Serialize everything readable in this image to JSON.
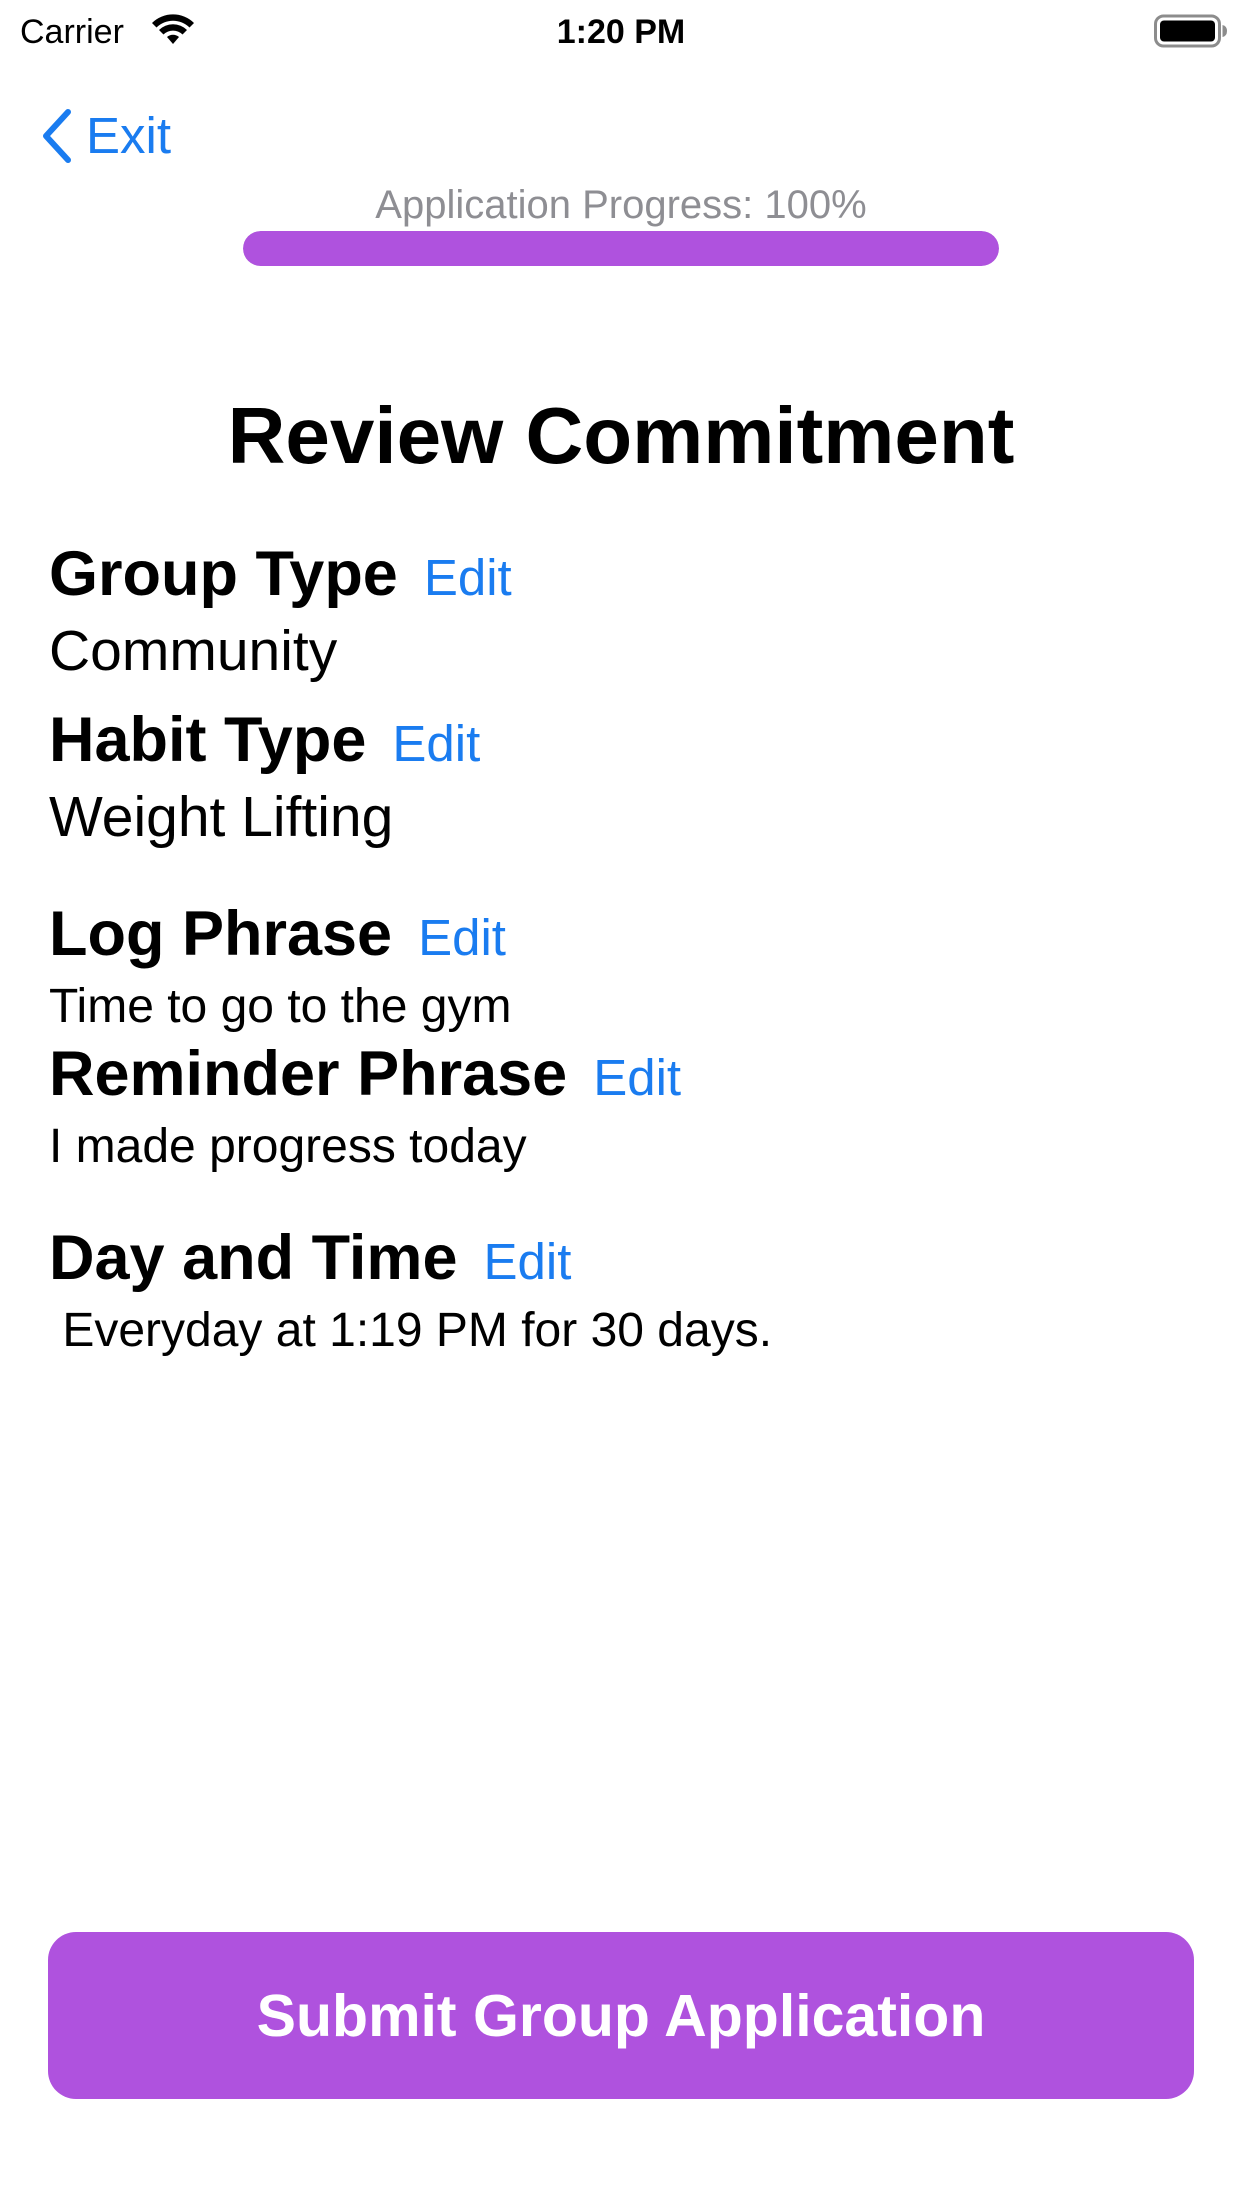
{
  "status_bar": {
    "carrier": "Carrier",
    "time": "1:20 PM",
    "wifi_icon": "wifi-icon",
    "battery_icon": "battery-full-icon"
  },
  "nav": {
    "back_label": "Exit",
    "back_icon": "chevron-left-icon"
  },
  "progress": {
    "label": "Application Progress: 100%",
    "value": 1.0
  },
  "title": "Review Commitment",
  "sections": [
    {
      "heading": "Group Type",
      "edit_label": "Edit",
      "value": "Community"
    },
    {
      "heading": "Habit Type",
      "edit_label": "Edit",
      "value": "Weight Lifting"
    },
    {
      "heading": "Log Phrase",
      "edit_label": "Edit",
      "value": "Time to go to the gym"
    },
    {
      "heading": "Reminder Phrase",
      "edit_label": "Edit",
      "value": "I made progress today"
    },
    {
      "heading": "Day and Time",
      "edit_label": "Edit",
      "value": " Everyday at 1:19 PM for 30 days."
    }
  ],
  "submit_label": "Submit Group Application",
  "colors": {
    "accent": "#af52de",
    "link": "#1a7cf0",
    "muted_text": "#8e8e93"
  }
}
